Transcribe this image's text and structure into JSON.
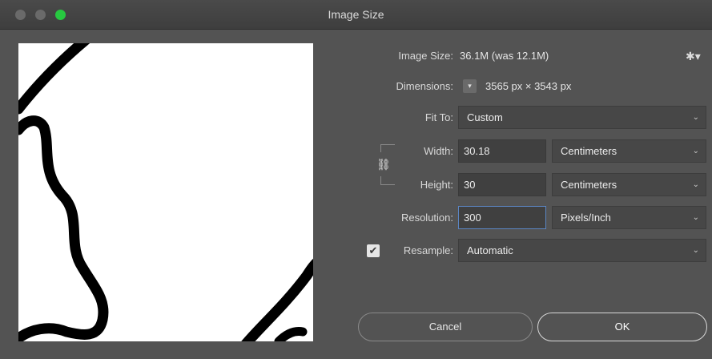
{
  "window": {
    "title": "Image Size"
  },
  "image_size": {
    "label": "Image Size:",
    "value": "36.1M (was 12.1M)"
  },
  "dimensions": {
    "label": "Dimensions:",
    "value": "3565 px  ×  3543 px"
  },
  "fit_to": {
    "label": "Fit To:",
    "value": "Custom"
  },
  "width": {
    "label": "Width:",
    "value": "30.18",
    "unit": "Centimeters"
  },
  "height": {
    "label": "Height:",
    "value": "30",
    "unit": "Centimeters"
  },
  "resolution": {
    "label": "Resolution:",
    "value": "300",
    "unit": "Pixels/Inch"
  },
  "resample": {
    "label": "Resample:",
    "value": "Automatic",
    "checked": true
  },
  "buttons": {
    "cancel": "Cancel",
    "ok": "OK"
  },
  "icons": {
    "gear": "gear-icon",
    "chain": "link-icon",
    "chevron": "chevron-down-icon",
    "check": "checkmark-icon"
  }
}
